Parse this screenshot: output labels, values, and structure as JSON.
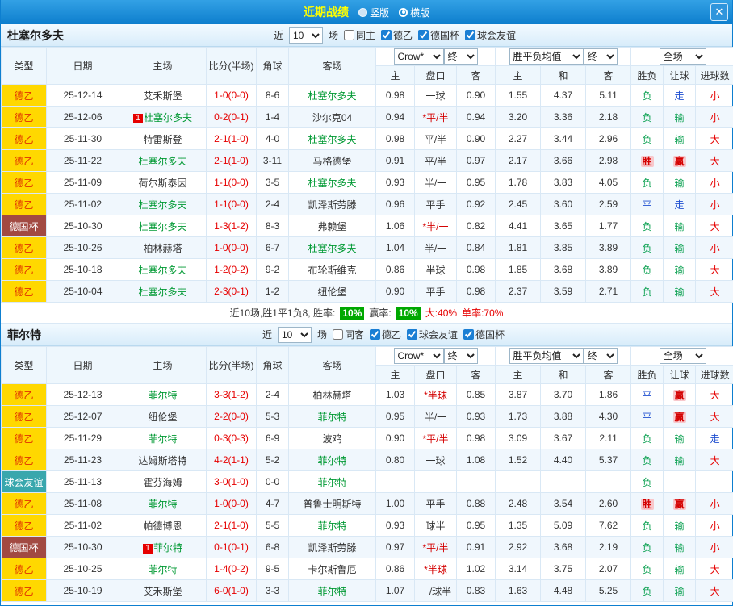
{
  "titlebar": {
    "title": "近期战绩",
    "vertical": "竖版",
    "horizontal": "横版",
    "close": "✕"
  },
  "controls": {
    "near": "近",
    "count": "10",
    "matches": "场",
    "bookmaker": "Crow*",
    "final": "终",
    "avg": "胜平负均值",
    "scope": "全场"
  },
  "columns": {
    "type": "类型",
    "date": "日期",
    "home": "主场",
    "score": "比分(半场)",
    "corners": "角球",
    "away": "客场",
    "home_odds": "主",
    "line": "盘口",
    "away_odds": "客",
    "avg_home": "主",
    "avg_draw": "和",
    "avg_away": "客",
    "result": "胜负",
    "handicap": "让球",
    "goals": "进球数"
  },
  "colors": {
    "accent_blue": "#0d7ecd",
    "title_yellow": "#ffff00",
    "league_de2_bg": "#ffd800",
    "league_cup_bg": "#a24a42",
    "league_friendly_bg": "#39a7ad",
    "score_red": "#e60000",
    "focus_team_green": "#009933",
    "win_red": "#d40000",
    "push_blue": "#2050d0",
    "loss_green": "#0aa050",
    "rate_badge_green": "#00a800"
  },
  "sections": [
    {
      "team": "杜塞尔多夫",
      "filters": [
        {
          "label": "同主",
          "checked": false
        },
        {
          "label": "德乙",
          "checked": true
        },
        {
          "label": "德国杯",
          "checked": true
        },
        {
          "label": "球会友谊",
          "checked": true
        }
      ],
      "rows": [
        {
          "league": "德乙",
          "date": "25-12-14",
          "home": "艾禾斯堡",
          "home_focus": false,
          "home_badge": "",
          "score": "1-0(0-0)",
          "corners": "8-6",
          "away": "杜塞尔多夫",
          "away_focus": true,
          "away_badge": "",
          "odds": [
            "0.98",
            "一球",
            "0.90"
          ],
          "avg": [
            "1.55",
            "4.37",
            "5.11"
          ],
          "result": "负",
          "handicap": "走",
          "goals": "小"
        },
        {
          "league": "德乙",
          "date": "25-12-06",
          "home": "杜塞尔多夫",
          "home_focus": true,
          "home_badge": "1",
          "score": "0-2(0-1)",
          "corners": "1-4",
          "away": "沙尔克04",
          "away_focus": false,
          "away_badge": "",
          "odds": [
            "0.94",
            "*平/半",
            "0.94"
          ],
          "avg": [
            "3.20",
            "3.36",
            "2.18"
          ],
          "result": "负",
          "handicap": "输",
          "goals": "小"
        },
        {
          "league": "德乙",
          "date": "25-11-30",
          "home": "特雷斯登",
          "home_focus": false,
          "home_badge": "",
          "score": "2-1(1-0)",
          "corners": "4-0",
          "away": "杜塞尔多夫",
          "away_focus": true,
          "away_badge": "",
          "odds": [
            "0.98",
            "平/半",
            "0.90"
          ],
          "avg": [
            "2.27",
            "3.44",
            "2.96"
          ],
          "result": "负",
          "handicap": "输",
          "goals": "大"
        },
        {
          "league": "德乙",
          "date": "25-11-22",
          "home": "杜塞尔多夫",
          "home_focus": true,
          "home_badge": "",
          "score": "2-1(1-0)",
          "corners": "3-11",
          "away": "马格德堡",
          "away_focus": false,
          "away_badge": "",
          "odds": [
            "0.91",
            "平/半",
            "0.97"
          ],
          "avg": [
            "2.17",
            "3.66",
            "2.98"
          ],
          "result": "胜",
          "handicap": "赢",
          "goals": "大"
        },
        {
          "league": "德乙",
          "date": "25-11-09",
          "home": "荷尔斯泰因",
          "home_focus": false,
          "home_badge": "",
          "score": "1-1(0-0)",
          "corners": "3-5",
          "away": "杜塞尔多夫",
          "away_focus": true,
          "away_badge": "",
          "odds": [
            "0.93",
            "半/一",
            "0.95"
          ],
          "avg": [
            "1.78",
            "3.83",
            "4.05"
          ],
          "result": "负",
          "handicap": "输",
          "goals": "小"
        },
        {
          "league": "德乙",
          "date": "25-11-02",
          "home": "杜塞尔多夫",
          "home_focus": true,
          "home_badge": "",
          "score": "1-1(0-0)",
          "corners": "2-4",
          "away": "凯泽斯劳滕",
          "away_focus": false,
          "away_badge": "",
          "odds": [
            "0.96",
            "平手",
            "0.92"
          ],
          "avg": [
            "2.45",
            "3.60",
            "2.59"
          ],
          "result": "平",
          "handicap": "走",
          "goals": "小"
        },
        {
          "league": "德国杯",
          "date": "25-10-30",
          "home": "杜塞尔多夫",
          "home_focus": true,
          "home_badge": "",
          "score": "1-3(1-2)",
          "corners": "8-3",
          "away": "弗赖堡",
          "away_focus": false,
          "away_badge": "",
          "odds": [
            "1.06",
            "*半/一",
            "0.82"
          ],
          "avg": [
            "4.41",
            "3.65",
            "1.77"
          ],
          "result": "负",
          "handicap": "输",
          "goals": "大"
        },
        {
          "league": "德乙",
          "date": "25-10-26",
          "home": "柏林赫塔",
          "home_focus": false,
          "home_badge": "",
          "score": "1-0(0-0)",
          "corners": "6-7",
          "away": "杜塞尔多夫",
          "away_focus": true,
          "away_badge": "",
          "odds": [
            "1.04",
            "半/一",
            "0.84"
          ],
          "avg": [
            "1.81",
            "3.85",
            "3.89"
          ],
          "result": "负",
          "handicap": "输",
          "goals": "小"
        },
        {
          "league": "德乙",
          "date": "25-10-18",
          "home": "杜塞尔多夫",
          "home_focus": true,
          "home_badge": "",
          "score": "1-2(0-2)",
          "corners": "9-2",
          "away": "布轮斯维克",
          "away_focus": false,
          "away_badge": "",
          "odds": [
            "0.86",
            "半球",
            "0.98"
          ],
          "avg": [
            "1.85",
            "3.68",
            "3.89"
          ],
          "result": "负",
          "handicap": "输",
          "goals": "大"
        },
        {
          "league": "德乙",
          "date": "25-10-04",
          "home": "杜塞尔多夫",
          "home_focus": true,
          "home_badge": "",
          "score": "2-3(0-1)",
          "corners": "1-2",
          "away": "纽伦堡",
          "away_focus": false,
          "away_badge": "",
          "odds": [
            "0.90",
            "平手",
            "0.98"
          ],
          "avg": [
            "2.37",
            "3.59",
            "2.71"
          ],
          "result": "负",
          "handicap": "输",
          "goals": "大"
        }
      ],
      "summary": {
        "prefix": "近10场,胜1平1负8, 胜率:",
        "win_rate": "10%",
        "mid": "赢率:",
        "cover_rate": "10%",
        "big_rate": "大:40%",
        "single_rate": "单率:70%"
      }
    },
    {
      "team": "菲尔特",
      "filters": [
        {
          "label": "同客",
          "checked": false
        },
        {
          "label": "德乙",
          "checked": true
        },
        {
          "label": "球会友谊",
          "checked": true
        },
        {
          "label": "德国杯",
          "checked": true
        }
      ],
      "rows": [
        {
          "league": "德乙",
          "date": "25-12-13",
          "home": "菲尔特",
          "home_focus": true,
          "home_badge": "",
          "score": "3-3(1-2)",
          "corners": "2-4",
          "away": "柏林赫塔",
          "away_focus": false,
          "away_badge": "",
          "odds": [
            "1.03",
            "*半球",
            "0.85"
          ],
          "avg": [
            "3.87",
            "3.70",
            "1.86"
          ],
          "result": "平",
          "handicap": "赢",
          "goals": "大"
        },
        {
          "league": "德乙",
          "date": "25-12-07",
          "home": "纽伦堡",
          "home_focus": false,
          "home_badge": "",
          "score": "2-2(0-0)",
          "corners": "5-3",
          "away": "菲尔特",
          "away_focus": true,
          "away_badge": "",
          "odds": [
            "0.95",
            "半/一",
            "0.93"
          ],
          "avg": [
            "1.73",
            "3.88",
            "4.30"
          ],
          "result": "平",
          "handicap": "赢",
          "goals": "大"
        },
        {
          "league": "德乙",
          "date": "25-11-29",
          "home": "菲尔特",
          "home_focus": true,
          "home_badge": "",
          "score": "0-3(0-3)",
          "corners": "6-9",
          "away": "波鸡",
          "away_focus": false,
          "away_badge": "",
          "odds": [
            "0.90",
            "*平/半",
            "0.98"
          ],
          "avg": [
            "3.09",
            "3.67",
            "2.11"
          ],
          "result": "负",
          "handicap": "输",
          "goals": "走"
        },
        {
          "league": "德乙",
          "date": "25-11-23",
          "home": "达姆斯塔特",
          "home_focus": false,
          "home_badge": "",
          "score": "4-2(1-1)",
          "corners": "5-2",
          "away": "菲尔特",
          "away_focus": true,
          "away_badge": "",
          "odds": [
            "0.80",
            "一球",
            "1.08"
          ],
          "avg": [
            "1.52",
            "4.40",
            "5.37"
          ],
          "result": "负",
          "handicap": "输",
          "goals": "大"
        },
        {
          "league": "球会友谊",
          "date": "25-11-13",
          "home": "霍芬海姆",
          "home_focus": false,
          "home_badge": "",
          "score": "3-0(1-0)",
          "corners": "0-0",
          "away": "菲尔特",
          "away_focus": true,
          "away_badge": "",
          "odds": [
            "",
            "",
            ""
          ],
          "avg": [
            "",
            "",
            ""
          ],
          "result": "负",
          "handicap": "",
          "goals": ""
        },
        {
          "league": "德乙",
          "date": "25-11-08",
          "home": "菲尔特",
          "home_focus": true,
          "home_badge": "",
          "score": "1-0(0-0)",
          "corners": "4-7",
          "away": "普鲁士明斯特",
          "away_focus": false,
          "away_badge": "",
          "odds": [
            "1.00",
            "平手",
            "0.88"
          ],
          "avg": [
            "2.48",
            "3.54",
            "2.60"
          ],
          "result": "胜",
          "handicap": "赢",
          "goals": "小"
        },
        {
          "league": "德乙",
          "date": "25-11-02",
          "home": "帕德博恩",
          "home_focus": false,
          "home_badge": "",
          "score": "2-1(1-0)",
          "corners": "5-5",
          "away": "菲尔特",
          "away_focus": true,
          "away_badge": "",
          "odds": [
            "0.93",
            "球半",
            "0.95"
          ],
          "avg": [
            "1.35",
            "5.09",
            "7.62"
          ],
          "result": "负",
          "handicap": "输",
          "goals": "小"
        },
        {
          "league": "德国杯",
          "date": "25-10-30",
          "home": "菲尔特",
          "home_focus": true,
          "home_badge": "1",
          "score": "0-1(0-1)",
          "corners": "6-8",
          "away": "凯泽斯劳滕",
          "away_focus": false,
          "away_badge": "",
          "odds": [
            "0.97",
            "*平/半",
            "0.91"
          ],
          "avg": [
            "2.92",
            "3.68",
            "2.19"
          ],
          "result": "负",
          "handicap": "输",
          "goals": "小"
        },
        {
          "league": "德乙",
          "date": "25-10-25",
          "home": "菲尔特",
          "home_focus": true,
          "home_badge": "",
          "score": "1-4(0-2)",
          "corners": "9-5",
          "away": "卡尔斯鲁厄",
          "away_focus": false,
          "away_badge": "",
          "odds": [
            "0.86",
            "*半球",
            "1.02"
          ],
          "avg": [
            "3.14",
            "3.75",
            "2.07"
          ],
          "result": "负",
          "handicap": "输",
          "goals": "大"
        },
        {
          "league": "德乙",
          "date": "25-10-19",
          "home": "艾禾斯堡",
          "home_focus": false,
          "home_badge": "",
          "score": "6-0(1-0)",
          "corners": "3-3",
          "away": "菲尔特",
          "away_focus": true,
          "away_badge": "",
          "odds": [
            "1.07",
            "一/球半",
            "0.83"
          ],
          "avg": [
            "1.63",
            "4.48",
            "5.25"
          ],
          "result": "负",
          "handicap": "输",
          "goals": "大"
        }
      ],
      "summary": null
    }
  ]
}
